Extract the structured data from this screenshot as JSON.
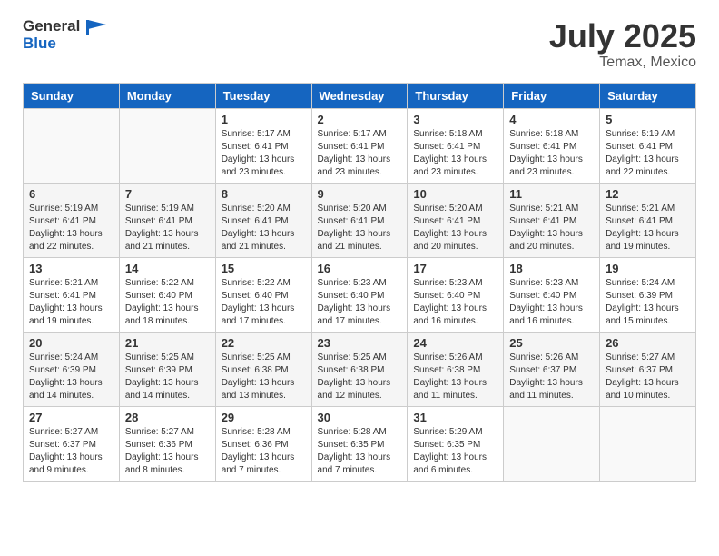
{
  "header": {
    "logo_general": "General",
    "logo_blue": "Blue",
    "month": "July 2025",
    "location": "Temax, Mexico"
  },
  "days_of_week": [
    "Sunday",
    "Monday",
    "Tuesday",
    "Wednesday",
    "Thursday",
    "Friday",
    "Saturday"
  ],
  "weeks": [
    [
      {
        "day": "",
        "info": ""
      },
      {
        "day": "",
        "info": ""
      },
      {
        "day": "1",
        "info": "Sunrise: 5:17 AM\nSunset: 6:41 PM\nDaylight: 13 hours and 23 minutes."
      },
      {
        "day": "2",
        "info": "Sunrise: 5:17 AM\nSunset: 6:41 PM\nDaylight: 13 hours and 23 minutes."
      },
      {
        "day": "3",
        "info": "Sunrise: 5:18 AM\nSunset: 6:41 PM\nDaylight: 13 hours and 23 minutes."
      },
      {
        "day": "4",
        "info": "Sunrise: 5:18 AM\nSunset: 6:41 PM\nDaylight: 13 hours and 23 minutes."
      },
      {
        "day": "5",
        "info": "Sunrise: 5:19 AM\nSunset: 6:41 PM\nDaylight: 13 hours and 22 minutes."
      }
    ],
    [
      {
        "day": "6",
        "info": "Sunrise: 5:19 AM\nSunset: 6:41 PM\nDaylight: 13 hours and 22 minutes."
      },
      {
        "day": "7",
        "info": "Sunrise: 5:19 AM\nSunset: 6:41 PM\nDaylight: 13 hours and 21 minutes."
      },
      {
        "day": "8",
        "info": "Sunrise: 5:20 AM\nSunset: 6:41 PM\nDaylight: 13 hours and 21 minutes."
      },
      {
        "day": "9",
        "info": "Sunrise: 5:20 AM\nSunset: 6:41 PM\nDaylight: 13 hours and 21 minutes."
      },
      {
        "day": "10",
        "info": "Sunrise: 5:20 AM\nSunset: 6:41 PM\nDaylight: 13 hours and 20 minutes."
      },
      {
        "day": "11",
        "info": "Sunrise: 5:21 AM\nSunset: 6:41 PM\nDaylight: 13 hours and 20 minutes."
      },
      {
        "day": "12",
        "info": "Sunrise: 5:21 AM\nSunset: 6:41 PM\nDaylight: 13 hours and 19 minutes."
      }
    ],
    [
      {
        "day": "13",
        "info": "Sunrise: 5:21 AM\nSunset: 6:41 PM\nDaylight: 13 hours and 19 minutes."
      },
      {
        "day": "14",
        "info": "Sunrise: 5:22 AM\nSunset: 6:40 PM\nDaylight: 13 hours and 18 minutes."
      },
      {
        "day": "15",
        "info": "Sunrise: 5:22 AM\nSunset: 6:40 PM\nDaylight: 13 hours and 17 minutes."
      },
      {
        "day": "16",
        "info": "Sunrise: 5:23 AM\nSunset: 6:40 PM\nDaylight: 13 hours and 17 minutes."
      },
      {
        "day": "17",
        "info": "Sunrise: 5:23 AM\nSunset: 6:40 PM\nDaylight: 13 hours and 16 minutes."
      },
      {
        "day": "18",
        "info": "Sunrise: 5:23 AM\nSunset: 6:40 PM\nDaylight: 13 hours and 16 minutes."
      },
      {
        "day": "19",
        "info": "Sunrise: 5:24 AM\nSunset: 6:39 PM\nDaylight: 13 hours and 15 minutes."
      }
    ],
    [
      {
        "day": "20",
        "info": "Sunrise: 5:24 AM\nSunset: 6:39 PM\nDaylight: 13 hours and 14 minutes."
      },
      {
        "day": "21",
        "info": "Sunrise: 5:25 AM\nSunset: 6:39 PM\nDaylight: 13 hours and 14 minutes."
      },
      {
        "day": "22",
        "info": "Sunrise: 5:25 AM\nSunset: 6:38 PM\nDaylight: 13 hours and 13 minutes."
      },
      {
        "day": "23",
        "info": "Sunrise: 5:25 AM\nSunset: 6:38 PM\nDaylight: 13 hours and 12 minutes."
      },
      {
        "day": "24",
        "info": "Sunrise: 5:26 AM\nSunset: 6:38 PM\nDaylight: 13 hours and 11 minutes."
      },
      {
        "day": "25",
        "info": "Sunrise: 5:26 AM\nSunset: 6:37 PM\nDaylight: 13 hours and 11 minutes."
      },
      {
        "day": "26",
        "info": "Sunrise: 5:27 AM\nSunset: 6:37 PM\nDaylight: 13 hours and 10 minutes."
      }
    ],
    [
      {
        "day": "27",
        "info": "Sunrise: 5:27 AM\nSunset: 6:37 PM\nDaylight: 13 hours and 9 minutes."
      },
      {
        "day": "28",
        "info": "Sunrise: 5:27 AM\nSunset: 6:36 PM\nDaylight: 13 hours and 8 minutes."
      },
      {
        "day": "29",
        "info": "Sunrise: 5:28 AM\nSunset: 6:36 PM\nDaylight: 13 hours and 7 minutes."
      },
      {
        "day": "30",
        "info": "Sunrise: 5:28 AM\nSunset: 6:35 PM\nDaylight: 13 hours and 7 minutes."
      },
      {
        "day": "31",
        "info": "Sunrise: 5:29 AM\nSunset: 6:35 PM\nDaylight: 13 hours and 6 minutes."
      },
      {
        "day": "",
        "info": ""
      },
      {
        "day": "",
        "info": ""
      }
    ]
  ]
}
